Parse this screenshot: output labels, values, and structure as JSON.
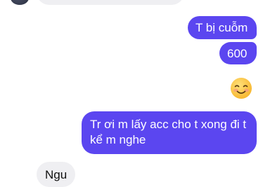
{
  "messages": {
    "sent_1": "T bị cuỗm",
    "sent_2": "600",
    "sent_emoji": "☺️",
    "sent_3": "Tr ơi m lấy acc cho t xong đi t kể m nghe",
    "received_1": "Ngu"
  },
  "colors": {
    "sent_bubble": "#5b46f0",
    "received_bubble": "#efeff2"
  },
  "icons": {
    "avatar": "contact-avatar",
    "emoji": "smiling-face-emoji"
  }
}
